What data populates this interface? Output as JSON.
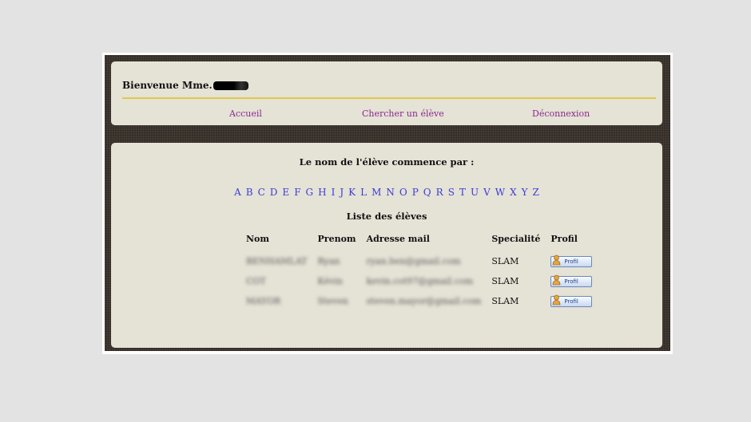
{
  "header": {
    "welcome": "Bienvenue Mme."
  },
  "nav": [
    {
      "label": "Accueil"
    },
    {
      "label": "Chercher un élève"
    },
    {
      "label": "Déconnexion"
    }
  ],
  "main": {
    "prompt": "Le nom de l'élève commence par :",
    "letters": [
      "A",
      "B",
      "C",
      "D",
      "E",
      "F",
      "G",
      "H",
      "I",
      "J",
      "K",
      "L",
      "M",
      "N",
      "O",
      "P",
      "Q",
      "R",
      "S",
      "T",
      "U",
      "V",
      "W",
      "X",
      "Y",
      "Z"
    ],
    "list_title": "Liste des élèves"
  },
  "table": {
    "columns": [
      "Nom",
      "Prenom",
      "Adresse mail",
      "Specialité",
      "Profil"
    ],
    "rows": [
      {
        "nom": "BENHAMLAT",
        "prenom": "Ryan",
        "email": "ryan.ben@gmail.com",
        "specialite": "SLAM",
        "profil": "Profil"
      },
      {
        "nom": "COT",
        "prenom": "Kévin",
        "email": "kevin.cot97@gmail.com",
        "specialite": "SLAM",
        "profil": "Profil"
      },
      {
        "nom": "MAYOR",
        "prenom": "Steven",
        "email": "steven.mayor@gmail.com",
        "specialite": "SLAM",
        "profil": "Profil"
      }
    ]
  }
}
